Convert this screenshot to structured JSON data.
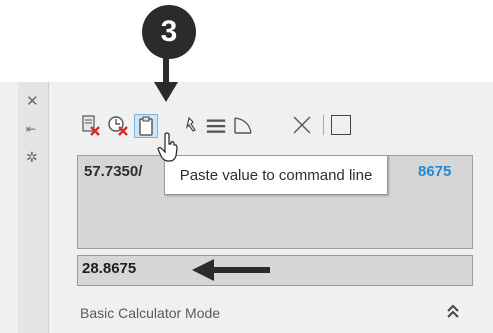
{
  "callout": {
    "step_number": "3"
  },
  "side_strip": {
    "icons": [
      "close-icon",
      "auto-hide-icon",
      "properties-icon"
    ],
    "close_glyph": "✕",
    "autohide_glyph": "⇤",
    "properties_glyph": "✲"
  },
  "toolbar": {
    "icons": [
      "clear-icon",
      "clear-history-icon",
      "paste-to-command-line-icon",
      "get-coordinates-icon",
      "distance-icon",
      "angle-icon",
      "intersection-icon",
      "help-icon"
    ],
    "help_glyph": "?"
  },
  "display": {
    "expression_text": "57.7350/",
    "result_tail_text": "8675",
    "result_tail_color": "#1f8ad8"
  },
  "tooltip": {
    "text": "Paste value to command line"
  },
  "input": {
    "value": "28.8675"
  },
  "footer": {
    "mode_label": "Basic Calculator Mode"
  }
}
